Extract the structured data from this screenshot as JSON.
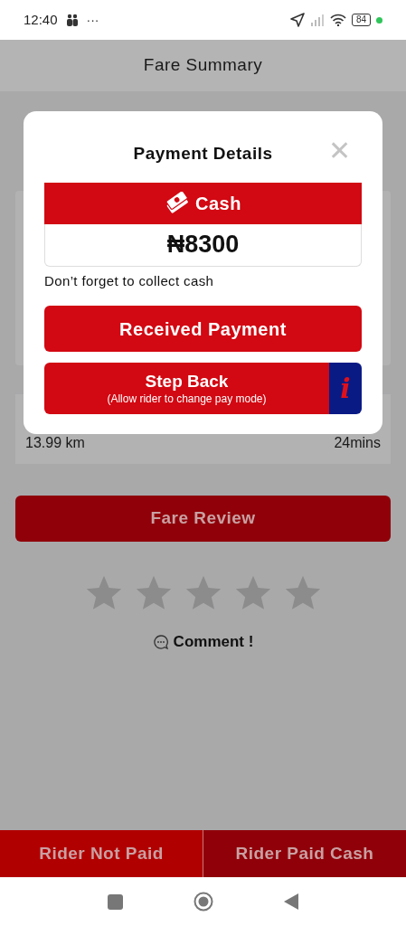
{
  "status_bar": {
    "time": "12:40",
    "more": "···",
    "battery": "84"
  },
  "header": {
    "title": "Fare Summary"
  },
  "summary": {
    "distance": "13.99 km",
    "duration": "24mins"
  },
  "fare_review": {
    "label": "Fare Review"
  },
  "rating": {
    "stars": 0
  },
  "comment": {
    "label": "Comment !"
  },
  "bottom_buttons": [
    {
      "label": "Rider Not Paid",
      "kind": "light"
    },
    {
      "label": "Rider Paid Cash",
      "kind": "dark"
    }
  ],
  "dialog": {
    "title": "Payment Details",
    "close": "✕",
    "method": "Cash",
    "amount": "₦8300",
    "note": "Don’t forget to collect cash",
    "primary": "Received Payment",
    "secondary": {
      "label": "Step Back",
      "sublabel": "(Allow rider to change pay mode)",
      "info": "i"
    }
  }
}
